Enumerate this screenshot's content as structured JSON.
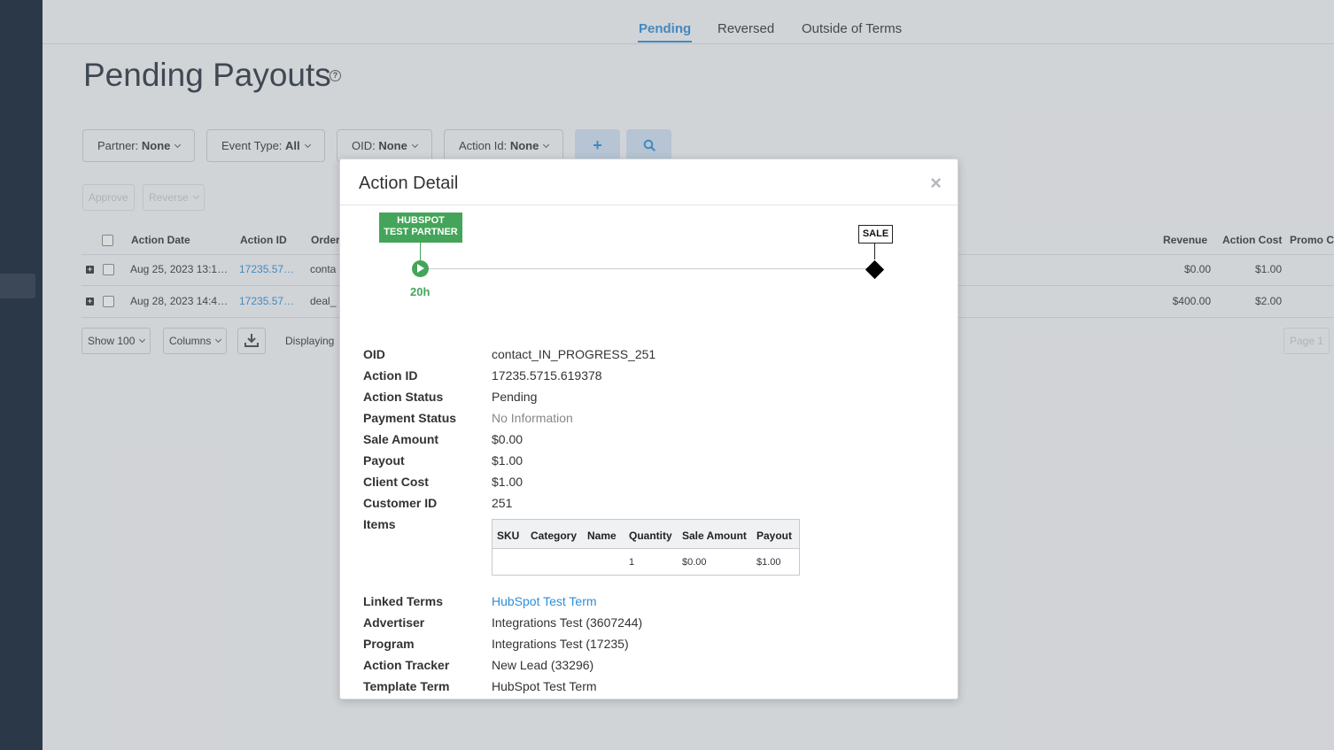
{
  "tabs": [
    {
      "label": "Pending",
      "active": true
    },
    {
      "label": "Reversed",
      "active": false
    },
    {
      "label": "Outside of Terms",
      "active": false
    }
  ],
  "page": {
    "title": "Pending Payouts",
    "help_glyph": "?"
  },
  "filters": [
    {
      "prefix": "Partner: ",
      "value": "None"
    },
    {
      "prefix": "Event Type: ",
      "value": "All"
    },
    {
      "prefix": "OID: ",
      "value": "None"
    },
    {
      "prefix": "Action Id: ",
      "value": "None"
    }
  ],
  "filter_icons": {
    "add": "+",
    "search_icon": "search-icon"
  },
  "bulk_actions": {
    "approve": "Approve",
    "reverse": "Reverse"
  },
  "table": {
    "headers": {
      "action_date": "Action Date",
      "action_id": "Action ID",
      "order": "Order",
      "revenue": "Revenue",
      "action_cost": "Action Cost",
      "promo": "Promo C"
    },
    "rows": [
      {
        "date": "Aug 25, 2023 13:1…",
        "action_id": "17235.57…",
        "order": "conta",
        "revenue": "$0.00",
        "action_cost": "$1.00"
      },
      {
        "date": "Aug 28, 2023 14:4…",
        "action_id": "17235.57…",
        "order": "deal_",
        "revenue": "$400.00",
        "action_cost": "$2.00"
      }
    ]
  },
  "footer": {
    "show": "Show 100",
    "columns": "Columns",
    "displaying": "Displaying",
    "page": "Page 1"
  },
  "modal": {
    "title": "Action Detail",
    "close_glyph": "×",
    "timeline": {
      "partner_line1": "HUBSPOT",
      "partner_line2": "TEST PARTNER",
      "duration": "20h",
      "end_label": "SALE"
    },
    "fields": [
      {
        "label": "OID",
        "value": "contact_IN_PROGRESS_251"
      },
      {
        "label": "Action ID",
        "value": "17235.5715.619378"
      },
      {
        "label": "Action Status",
        "value": "Pending"
      },
      {
        "label": "Payment Status",
        "value": "No Information"
      },
      {
        "label": "Sale Amount",
        "value": "$0.00"
      },
      {
        "label": "Payout",
        "value": "$1.00"
      },
      {
        "label": "Client Cost",
        "value": "$1.00"
      },
      {
        "label": "Customer ID",
        "value": "251"
      }
    ],
    "items_label": "Items",
    "items_table": {
      "headers": [
        "SKU",
        "Category",
        "Name",
        "Quantity",
        "Sale Amount",
        "Payout"
      ],
      "row": {
        "sku": "",
        "category": "",
        "name": "",
        "quantity": "1",
        "sale_amount": "$0.00",
        "payout": "$1.00"
      }
    },
    "fields2": [
      {
        "label": "Linked Terms",
        "value": "HubSpot Test Term"
      },
      {
        "label": "Advertiser",
        "value": "Integrations Test (3607244)"
      },
      {
        "label": "Program",
        "value": "Integrations Test (17235)"
      },
      {
        "label": "Action Tracker",
        "value": "New Lead (33296)"
      },
      {
        "label": "Template Term",
        "value": "HubSpot Test Term"
      }
    ]
  },
  "colors": {
    "accent": "#2f8ed8",
    "partner_green": "#44a55a",
    "rail": "#2b3847"
  }
}
